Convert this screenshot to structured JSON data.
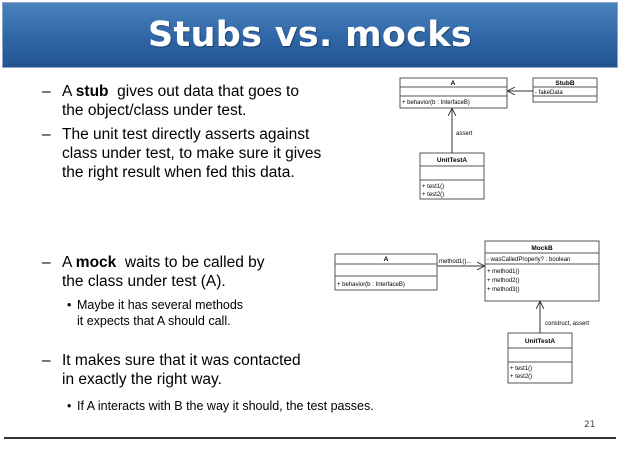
{
  "slide": {
    "title": "Stubs vs. mocks",
    "page_number": "21"
  },
  "bullets": {
    "stub": {
      "dash": "–",
      "line1_prefix": "A ",
      "line1_bold": "stub",
      "line1_suffix": "  gives out data that goes to",
      "line2": "the object/class under test."
    },
    "unit_test": {
      "dash": "–",
      "line1": "The unit test directly asserts against",
      "line2": "class under test, to make sure it gives",
      "line3": "the right result when fed this data."
    },
    "mock": {
      "dash": "–",
      "line1_prefix": "A ",
      "line1_bold": "mock",
      "line1_suffix": "  waits to be called by",
      "line2": "the class under test (A).",
      "sub_dot": "•",
      "sub_line1": "Maybe it has several methods",
      "sub_line2": "it expects that A should call."
    },
    "contact": {
      "dash": "–",
      "line1": "It makes sure that it was contacted",
      "line2": "in exactly the right way.",
      "sub_dot": "•",
      "sub_line1": "If A interacts with B the way it should, the test passes."
    }
  },
  "diagram_stub": {
    "class_a": {
      "name": "A",
      "method": "+ behavior(b : InterfaceB)"
    },
    "class_stub": {
      "name": "StubB",
      "attribute": "- fakeData"
    },
    "class_test": {
      "name": "UnitTestA",
      "method1": "+ test1()",
      "method2": "+ test2()"
    },
    "assert_label": "assert"
  },
  "diagram_mock": {
    "class_a": {
      "name": "A",
      "method": "+ behavior(b : InterfaceB)"
    },
    "class_mock": {
      "name": "MockB",
      "attribute": "- wasCalledProperly? : boolean",
      "method1": "+ method1()",
      "method2": "+ method2()",
      "method3": "+ method3()"
    },
    "class_test": {
      "name": "UnitTestA",
      "method1": "+ test1()",
      "method2": "+ test2()"
    },
    "call_label": "method1()...",
    "construct_label": "construct, assert"
  }
}
